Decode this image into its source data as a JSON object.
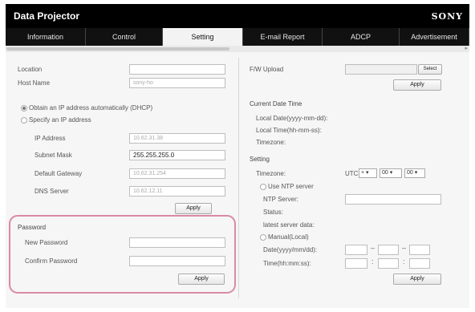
{
  "header": {
    "title": "Data Projector",
    "brand": "SONY"
  },
  "tabs": [
    {
      "label": "Information"
    },
    {
      "label": "Control"
    },
    {
      "label": "Setting"
    },
    {
      "label": "E-mail Report"
    },
    {
      "label": "ADCP"
    },
    {
      "label": "Advertisement"
    }
  ],
  "left": {
    "location_label": "Location",
    "location_value": "",
    "host_label": "Host Name",
    "host_value": "sony-ho",
    "dhcp_label": "Obtain an IP address automatically (DHCP)",
    "specify_label": "Specify an IP address",
    "ip_label": "IP Address",
    "ip_value": "10.62.31.38",
    "mask_label": "Subnet Mask",
    "mask_value": "255.255.255.0",
    "gateway_label": "Default Gateway",
    "gateway_value": "10.62.31.254",
    "dns_label": "DNS Server",
    "dns_value": "10.62.12.11",
    "apply_label": "Apply"
  },
  "password": {
    "title": "Password",
    "new_label": "New Password",
    "confirm_label": "Confirm Password",
    "apply_label": "Apply"
  },
  "right": {
    "fw_label": "F/W Upload",
    "select_label": "Select",
    "apply_label": "Apply",
    "current_title": "Current Date Time",
    "local_date_label": "Local Date(yyyy-mm-dd):",
    "local_time_label": "Local Time(hh-mm-ss):",
    "timezone_label": "Timezone:",
    "setting_title": "Setting",
    "tz_label": "Timezone:",
    "utc_label": "UTC",
    "tz_sign": "+",
    "tz_hour": "00",
    "tz_min": "00",
    "ntp_use_label": "Use NTP server",
    "ntp_server_label": "NTP Server:",
    "status_label": "Status:",
    "latest_label": "latest server data:",
    "manual_label": "Manual(Local)",
    "date_label": "Date(yyyy/mm/dd):",
    "time_label": "Time(hh:mm:ss):",
    "date_sep": "–",
    "time_sep": ":",
    "apply2_label": "Apply"
  }
}
